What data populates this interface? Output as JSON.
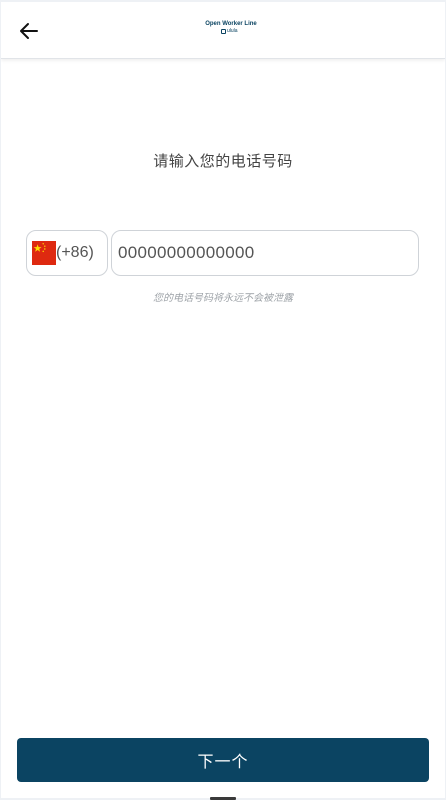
{
  "header": {
    "back_icon": "arrow-left-icon",
    "logo_title": "Open Worker Line",
    "logo_sub": "ulula"
  },
  "main": {
    "prompt": "请输入您的电话号码",
    "country": {
      "flag_icon": "china-flag-icon",
      "code": "(+86)"
    },
    "phone": {
      "value": "00000000000000"
    },
    "hint": "您的电话号码将永远不会被泄露"
  },
  "footer": {
    "next_label": "下一个"
  },
  "colors": {
    "primary": "#0b4462",
    "flag_red": "#de2910",
    "flag_yellow": "#ffde00"
  }
}
